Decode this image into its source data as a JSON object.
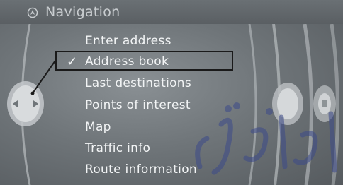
{
  "header": {
    "title": "Navigation",
    "icon": "navigation-compass-icon"
  },
  "menu": {
    "selected_index": 1,
    "items": [
      {
        "label": "Enter address"
      },
      {
        "label": "Address book"
      },
      {
        "label": "Last destinations"
      },
      {
        "label": "Points of interest"
      },
      {
        "label": "Map"
      },
      {
        "label": "Traffic info"
      },
      {
        "label": "Route information"
      }
    ]
  },
  "icons": {
    "check": "✓",
    "left_controller": "controller-left-right-icon",
    "right_controller": "controller-knob-icon"
  },
  "colors": {
    "screen_bg": "#6f7579",
    "text": "#f2f4f5",
    "header_text": "#c9cdd0",
    "frame": "#1a1a1a",
    "watermark": "#3c4a8a"
  }
}
